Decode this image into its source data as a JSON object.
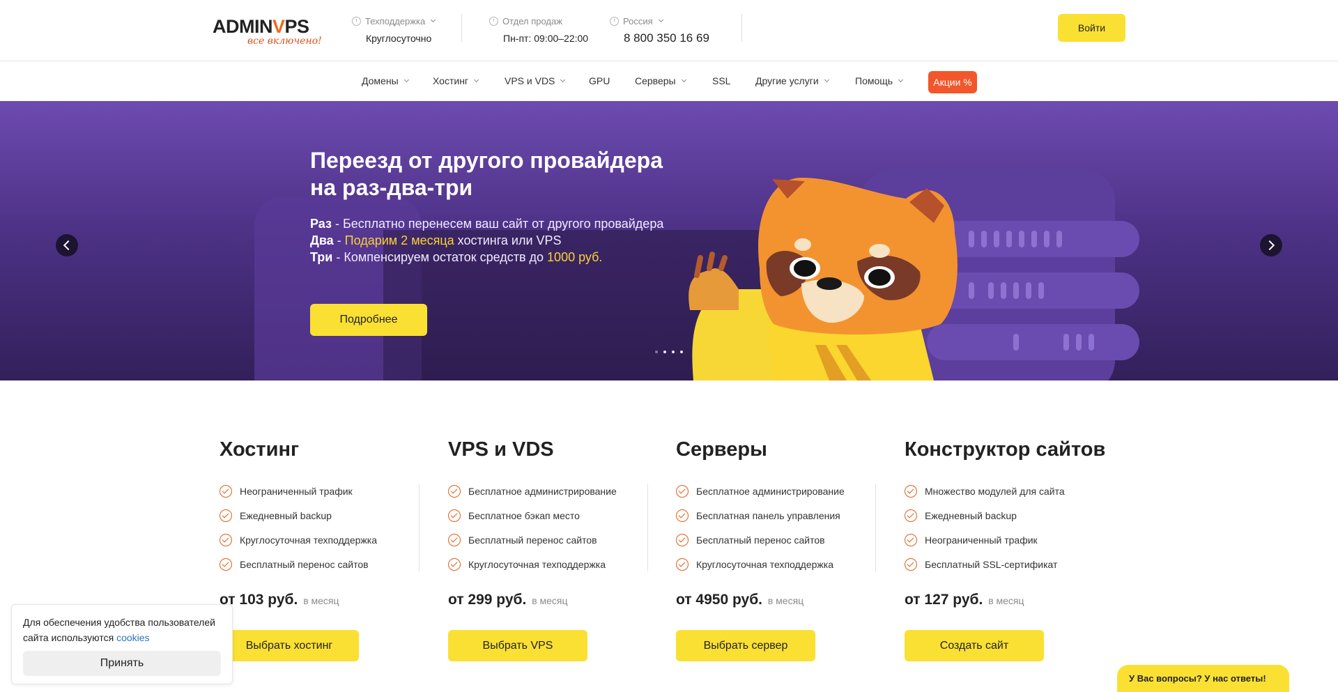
{
  "header": {
    "logo": {
      "brand": "ADMINVPS",
      "brand_prefix": "ADMIN",
      "brand_v": "V",
      "brand_suffix": "PS",
      "tagline": "все включено!"
    },
    "support": {
      "label": "Техподдержка",
      "value": "Круглосуточно"
    },
    "sales": {
      "label": "Отдел продаж",
      "value": "Пн-пт: 09:00–22:00"
    },
    "region": {
      "label": "Россия",
      "phone": "8 800 350 16 69"
    },
    "login_label": "Войти"
  },
  "nav": {
    "items": [
      {
        "label": "Домены",
        "dropdown": true
      },
      {
        "label": "Хостинг",
        "dropdown": true
      },
      {
        "label": "VPS и VDS",
        "dropdown": true
      },
      {
        "label": "GPU",
        "dropdown": false
      },
      {
        "label": "Серверы",
        "dropdown": true
      },
      {
        "label": "SSL",
        "dropdown": false
      },
      {
        "label": "Другие услуги",
        "dropdown": true
      },
      {
        "label": "Помощь",
        "dropdown": true
      }
    ],
    "promo_label": "Акции %"
  },
  "hero": {
    "title_line1": "Переезд от другого провайдера",
    "title_line2": "на раз-два-три",
    "line1_bold": "Раз",
    "line1_text": " - Бесплатно перенесем ваш сайт от другого провайдера",
    "line2_bold": "Два",
    "line2_dash": " - ",
    "line2_highlight": "Подарим 2 месяца",
    "line2_text": " хостинга или VPS",
    "line3_bold": "Три",
    "line3_text": " - Компенсируем остаток средств до ",
    "line3_highlight": "1000 руб.",
    "button_label": "Подробнее",
    "slides_count": 4,
    "active_slide": 2
  },
  "products": [
    {
      "title": "Хостинг",
      "features": [
        "Неограниченный трафик",
        "Ежедневный backup",
        "Круглосуточная техподдержка",
        "Бесплатный перенос сайтов"
      ],
      "price": "от 103 руб.",
      "unit": "в месяц",
      "button": "Выбрать хостинг"
    },
    {
      "title": "VPS и VDS",
      "features": [
        "Бесплатное администрирование",
        "Бесплатное бэкап место",
        "Бесплатный перенос сайтов",
        "Круглосуточная техподдержка"
      ],
      "price": "от 299 руб.",
      "unit": "в месяц",
      "button": "Выбрать VPS"
    },
    {
      "title": "Серверы",
      "features": [
        "Бесплатное администрирование",
        "Бесплатная панель управления",
        "Бесплатный перенос сайтов",
        "Круглосуточная техподдержка"
      ],
      "price": "от 4950 руб.",
      "unit": "в месяц",
      "button": "Выбрать сервер"
    },
    {
      "title": "Конструктор сайтов",
      "features": [
        "Множество модулей для сайта",
        "Ежедневный backup",
        "Неограниченный трафик",
        "Бесплатный SSL-сертификат"
      ],
      "price": "от 127 руб.",
      "unit": "в месяц",
      "button": "Создать сайт"
    }
  ],
  "cookie": {
    "text": "Для обеспечения удобства пользователей сайта используются ",
    "link": "cookies",
    "accept": "Принять"
  },
  "faq_label": "У Вас вопросы? У нас ответы!",
  "colors": {
    "accent_yellow": "#fae033",
    "accent_orange": "#f2562b",
    "hero_purple": "#6d4bb0"
  }
}
